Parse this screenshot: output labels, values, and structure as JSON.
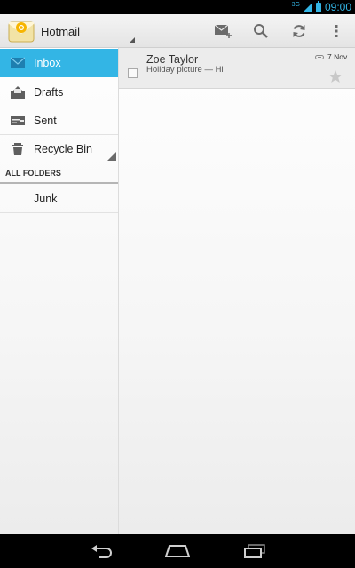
{
  "status_bar": {
    "network": "3G",
    "time": "09:00",
    "accent_color": "#33b5e5"
  },
  "action_bar": {
    "title": "Hotmail",
    "app_icon": "hotmail-envelope-icon",
    "actions": [
      {
        "name": "compose",
        "icon": "compose-mail-icon"
      },
      {
        "name": "search",
        "icon": "search-icon"
      },
      {
        "name": "refresh",
        "icon": "refresh-icon"
      },
      {
        "name": "overflow",
        "icon": "overflow-menu-icon"
      }
    ]
  },
  "sidebar": {
    "folders": [
      {
        "label": "Inbox",
        "icon": "inbox-icon",
        "active": true
      },
      {
        "label": "Drafts",
        "icon": "drafts-icon",
        "active": false
      },
      {
        "label": "Sent",
        "icon": "sent-icon",
        "active": false
      },
      {
        "label": "Recycle Bin",
        "icon": "trash-icon",
        "active": false
      }
    ],
    "section_header": "ALL FOLDERS",
    "other_folders": [
      {
        "label": "Junk"
      }
    ]
  },
  "messages": [
    {
      "sender": "Zoe Taylor",
      "subject": "Holiday picture — Hi",
      "date": "7 Nov",
      "has_attachment": true,
      "starred": false
    }
  ],
  "colors": {
    "active_folder": "#33b5e5",
    "star": "#c8c8c8"
  }
}
